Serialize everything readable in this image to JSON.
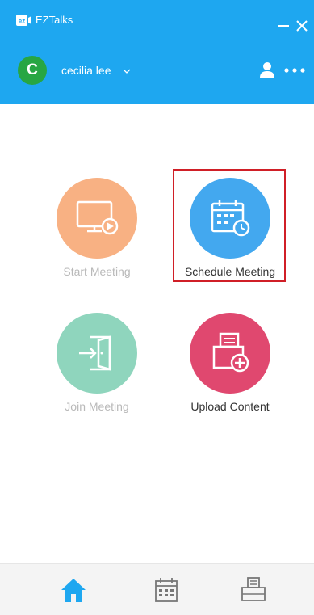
{
  "app": {
    "title": "EZTalks",
    "logo_text": "ez",
    "brand_color": "#1ea7f0"
  },
  "window_controls": {
    "minimize_icon": "minimize-icon",
    "close_icon": "close-icon"
  },
  "user": {
    "avatar_initial": "C",
    "avatar_color": "#27a643",
    "name": "cecilia lee",
    "menu_icon": "chevron-down-icon",
    "profile_icon": "user-icon",
    "more_icon": "more-dots-icon"
  },
  "actions": [
    {
      "label": "Start Meeting",
      "icon": "monitor-play-icon",
      "color": "#f8b183",
      "enabled": false
    },
    {
      "label": "Schedule Meeting",
      "icon": "calendar-clock-icon",
      "color": "#43a8ef",
      "enabled": true,
      "highlighted": true
    },
    {
      "label": "Join Meeting",
      "icon": "door-enter-icon",
      "color": "#8fd5bd",
      "enabled": false
    },
    {
      "label": "Upload Content",
      "icon": "document-add-icon",
      "color": "#e0486f",
      "enabled": true
    }
  ],
  "highlight_color": "#d01f27",
  "bottom_nav": [
    {
      "icon": "home-icon",
      "active": true,
      "color": "#1ea7f0"
    },
    {
      "icon": "calendar-icon",
      "active": false,
      "color": "#777777"
    },
    {
      "icon": "printer-icon",
      "active": false,
      "color": "#777777"
    }
  ]
}
